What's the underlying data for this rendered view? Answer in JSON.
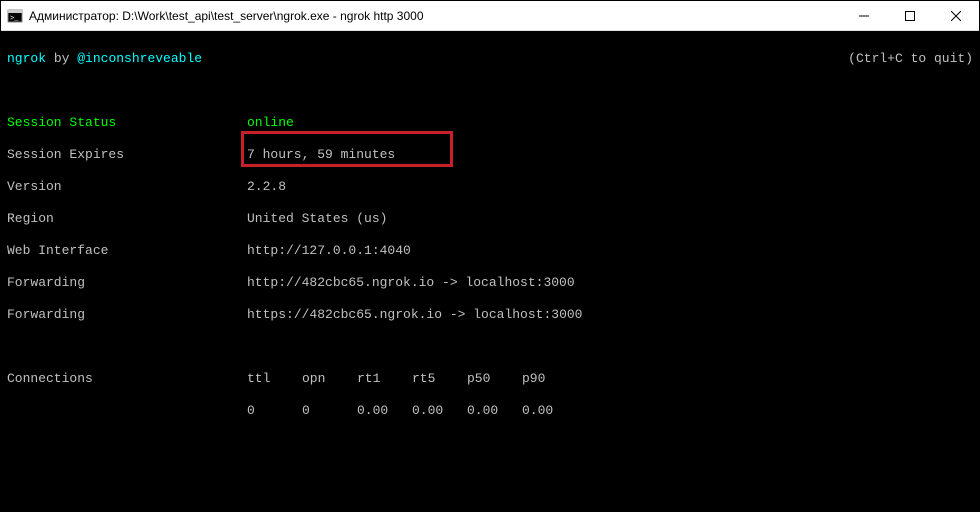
{
  "window": {
    "title": "Администратор: D:\\Work\\test_api\\test_server\\ngrok.exe - ngrok  http 3000"
  },
  "header": {
    "app": "ngrok",
    "by": " by ",
    "author": "@inconshreveable",
    "quit_hint": "(Ctrl+C to quit)"
  },
  "session": {
    "status_label": "Session Status",
    "status_value": "online",
    "expires_label": "Session Expires",
    "expires_value": "7 hours, 59 minutes",
    "version_label": "Version",
    "version_value": "2.2.8",
    "region_label": "Region",
    "region_value": "United States (us)",
    "web_label": "Web Interface",
    "web_value": "http://127.0.0.1:4040",
    "fwd1_label": "Forwarding",
    "fwd1_url": "http://482cbc65.ngrok.io",
    "fwd1_arrow": " -> localhost:3000",
    "fwd2_label": "Forwarding",
    "fwd2_url": "https://482cbc65.ngrok.io",
    "fwd2_arrow": " -> localhost:3000"
  },
  "connections": {
    "label": "Connections",
    "headers": {
      "ttl": "ttl",
      "opn": "opn",
      "rt1": "rt1",
      "rt5": "rt5",
      "p50": "p50",
      "p90": "p90"
    },
    "values": {
      "ttl": "0",
      "opn": "0",
      "rt1": "0.00",
      "rt5": "0.00",
      "p50": "0.00",
      "p90": "0.00"
    }
  }
}
